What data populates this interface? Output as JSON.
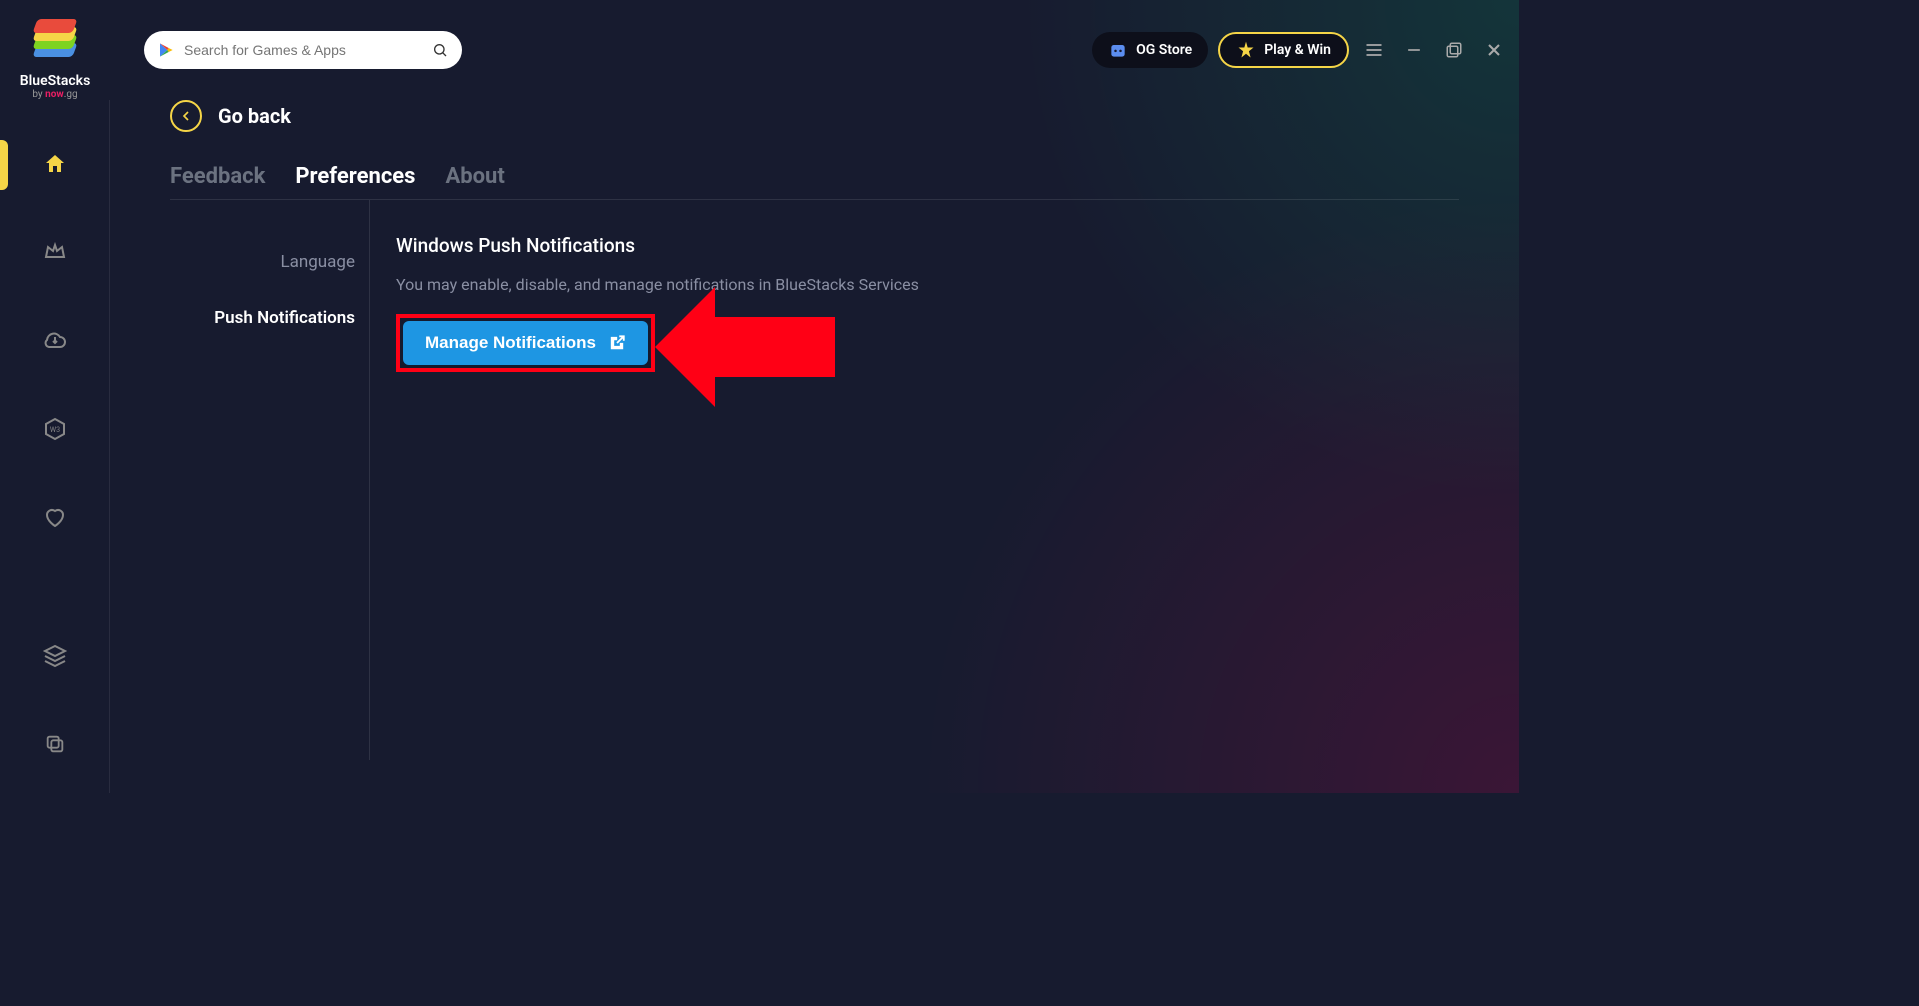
{
  "brand": {
    "name": "BlueStacks",
    "byline_prefix": "by ",
    "byline_brand": "now",
    "byline_suffix": ".gg"
  },
  "search": {
    "placeholder": "Search for Games & Apps"
  },
  "header": {
    "og_store": "OG Store",
    "play_win": "Play & Win"
  },
  "nav": {
    "go_back": "Go back"
  },
  "tabs": {
    "feedback": "Feedback",
    "preferences": "Preferences",
    "about": "About"
  },
  "prefs_sidebar": {
    "language": "Language",
    "push": "Push Notifications"
  },
  "section": {
    "title": "Windows Push Notifications",
    "desc": "You may enable, disable, and manage notifications in BlueStacks Services",
    "button": "Manage Notifications"
  }
}
